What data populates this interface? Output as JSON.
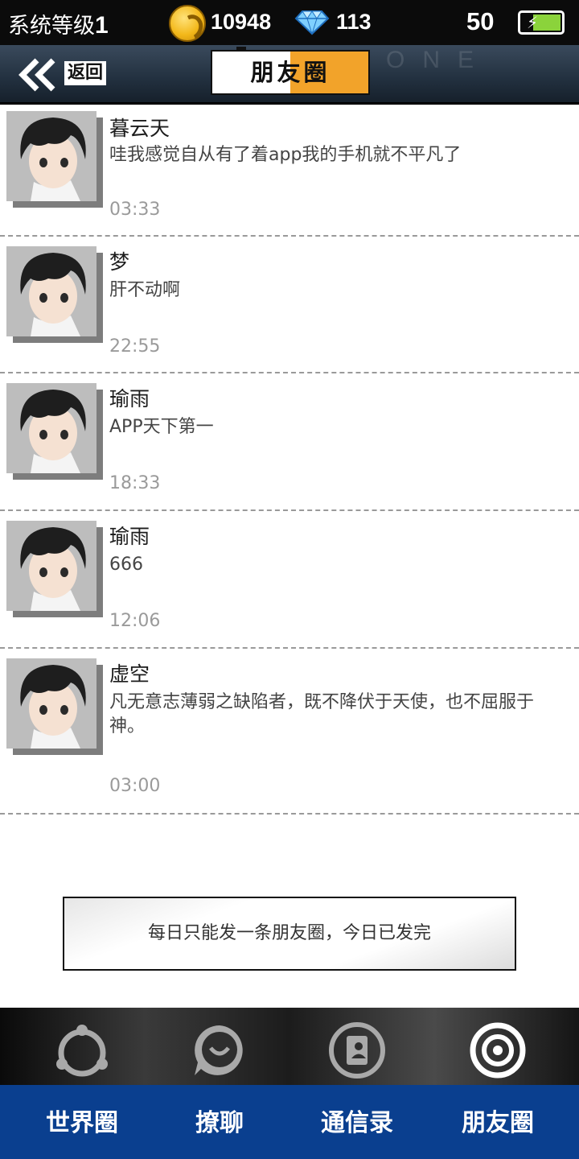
{
  "status_bar": {
    "level_label": "系统等级",
    "level_value": "1",
    "coins": "10948",
    "gems": "113",
    "energy": "50",
    "battery_color": "#8bd33b"
  },
  "header": {
    "back_label": "返回",
    "title": "朋友圈",
    "accent_color": "#f2a32a"
  },
  "posts": [
    {
      "name": "暮云天",
      "text": "哇我感觉自从有了着app我的手机就不平凡了",
      "time": "03:33"
    },
    {
      "name": "梦",
      "text": "肝不动啊",
      "time": "22:55"
    },
    {
      "name": "瑜雨",
      "text": "APP天下第一",
      "time": "18:33"
    },
    {
      "name": "瑜雨",
      "text": "666",
      "time": "12:06"
    },
    {
      "name": "虚空",
      "text": "凡无意志薄弱之缺陷者，既不降伏于天使，也不屈服于\n神。",
      "time": "03:00"
    }
  ],
  "notice": "每日只能发一条朋友圈，今日已发完",
  "bottom_nav": {
    "background_color": "#0a3f8f",
    "items": [
      {
        "label": "世界圈",
        "icon": "share-circle-icon"
      },
      {
        "label": "撩聊",
        "icon": "chat-bubble-icon"
      },
      {
        "label": "通信录",
        "icon": "contacts-book-icon"
      },
      {
        "label": "朋友圈",
        "icon": "moments-target-icon",
        "active": true
      }
    ]
  }
}
